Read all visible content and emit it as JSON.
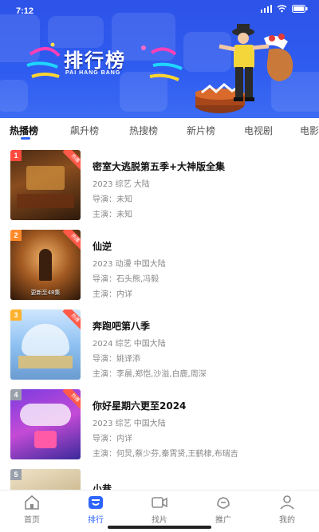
{
  "status_bar": {
    "time": "7:12"
  },
  "banner": {
    "title": "排行榜",
    "subtitle": "PAI HANG BANG"
  },
  "tabs": [
    {
      "label": "热播榜",
      "active": true
    },
    {
      "label": "飙升榜",
      "active": false
    },
    {
      "label": "热搜榜",
      "active": false
    },
    {
      "label": "新片榜",
      "active": false
    },
    {
      "label": "电视剧",
      "active": false
    },
    {
      "label": "电影",
      "active": false
    }
  ],
  "items": [
    {
      "rank": "1",
      "title": "密室大逃脱第五季+大神版全集",
      "info": "2023  综艺  大陆",
      "director": "导演：未知",
      "cast": "主演：未知",
      "tag": "热播",
      "rank_color": "#ff4b3e",
      "caption": ""
    },
    {
      "rank": "2",
      "title": "仙逆",
      "info": "2023  动漫  中国大陆",
      "director": "导演：石头熊,冯毅",
      "cast": "主演：内详",
      "tag": "热播",
      "rank_color": "#ff8a2b",
      "caption": "更新至48集"
    },
    {
      "rank": "3",
      "title": "奔跑吧第八季",
      "info": "2024  综艺  中国大陆",
      "director": "导演：姚译添",
      "cast": "主演：李晨,郑恺,沙溢,白鹿,周深",
      "tag": "热播",
      "rank_color": "#ffb12e",
      "caption": ""
    },
    {
      "rank": "4",
      "title": "你好星期六更至2024",
      "info": "2023  综艺  中国大陆",
      "director": "导演：内详",
      "cast": "主演：何炅,蔡少芬,秦霄贤,王鹤棣,布瑞吉",
      "tag": "热播",
      "rank_color": "#9aa0aa",
      "caption": ""
    },
    {
      "rank": "5",
      "title": "小巷",
      "info": "",
      "director": "",
      "cast": "",
      "tag": "",
      "rank_color": "#9aa0aa",
      "caption": ""
    }
  ],
  "bottom_nav": [
    {
      "label": "首页",
      "icon": "home-icon",
      "active": false
    },
    {
      "label": "排行",
      "icon": "ranking-icon",
      "active": true
    },
    {
      "label": "找片",
      "icon": "film-icon",
      "active": false
    },
    {
      "label": "推广",
      "icon": "share-icon",
      "active": false
    },
    {
      "label": "我的",
      "icon": "user-icon",
      "active": false
    }
  ]
}
